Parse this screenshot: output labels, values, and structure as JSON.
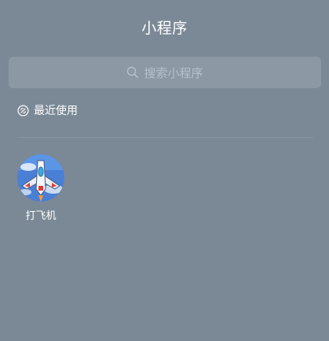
{
  "header": {
    "title": "小程序"
  },
  "search": {
    "icon": "search-icon",
    "placeholder": "搜索小程序"
  },
  "recent": {
    "icon": "recent-icon",
    "label": "最近使用"
  },
  "apps": [
    {
      "name": "打飞机",
      "icon": "plane-game-icon"
    }
  ],
  "colors": {
    "background": "#7b8996",
    "search_bg": "#8c99a5",
    "placeholder": "#b7c0c8",
    "text": "#ffffff"
  }
}
